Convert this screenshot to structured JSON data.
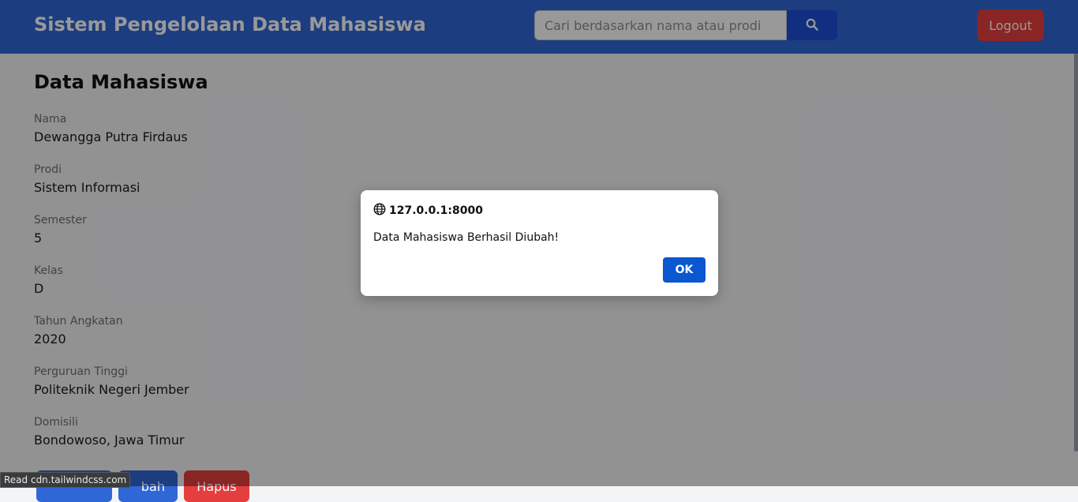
{
  "navbar": {
    "title": "Sistem Pengelolaan Data Mahasiswa",
    "search_placeholder": "Cari berdasarkan nama atau prodi",
    "search_icon": "search-icon",
    "logout_label": "Logout"
  },
  "page": {
    "title": "Data Mahasiswa"
  },
  "fields": [
    {
      "label": "Nama",
      "value": "Dewangga Putra Firdaus"
    },
    {
      "label": "Prodi",
      "value": "Sistem Informasi"
    },
    {
      "label": "Semester",
      "value": "5"
    },
    {
      "label": "Kelas",
      "value": "D"
    },
    {
      "label": "Tahun Angkatan",
      "value": "2020"
    },
    {
      "label": "Perguruan Tinggi",
      "value": "Politeknik Negeri Jember"
    },
    {
      "label": "Domisili",
      "value": "Bondowoso, Jawa Timur"
    }
  ],
  "actions": {
    "edit_label_fragment": "bah",
    "delete_label": "Hapus"
  },
  "dialog": {
    "origin": "127.0.0.1:8000",
    "message": "Data Mahasiswa Berhasil Diubah!",
    "ok_label": "OK",
    "origin_icon": "globe-icon"
  },
  "status_bar": {
    "text": "Read cdn.tailwindcss.com"
  },
  "colors": {
    "navbar": "#2f67d6",
    "search_button": "#1d4ed8",
    "danger": "#e53e3e",
    "dialog_button": "#0b57d0"
  }
}
